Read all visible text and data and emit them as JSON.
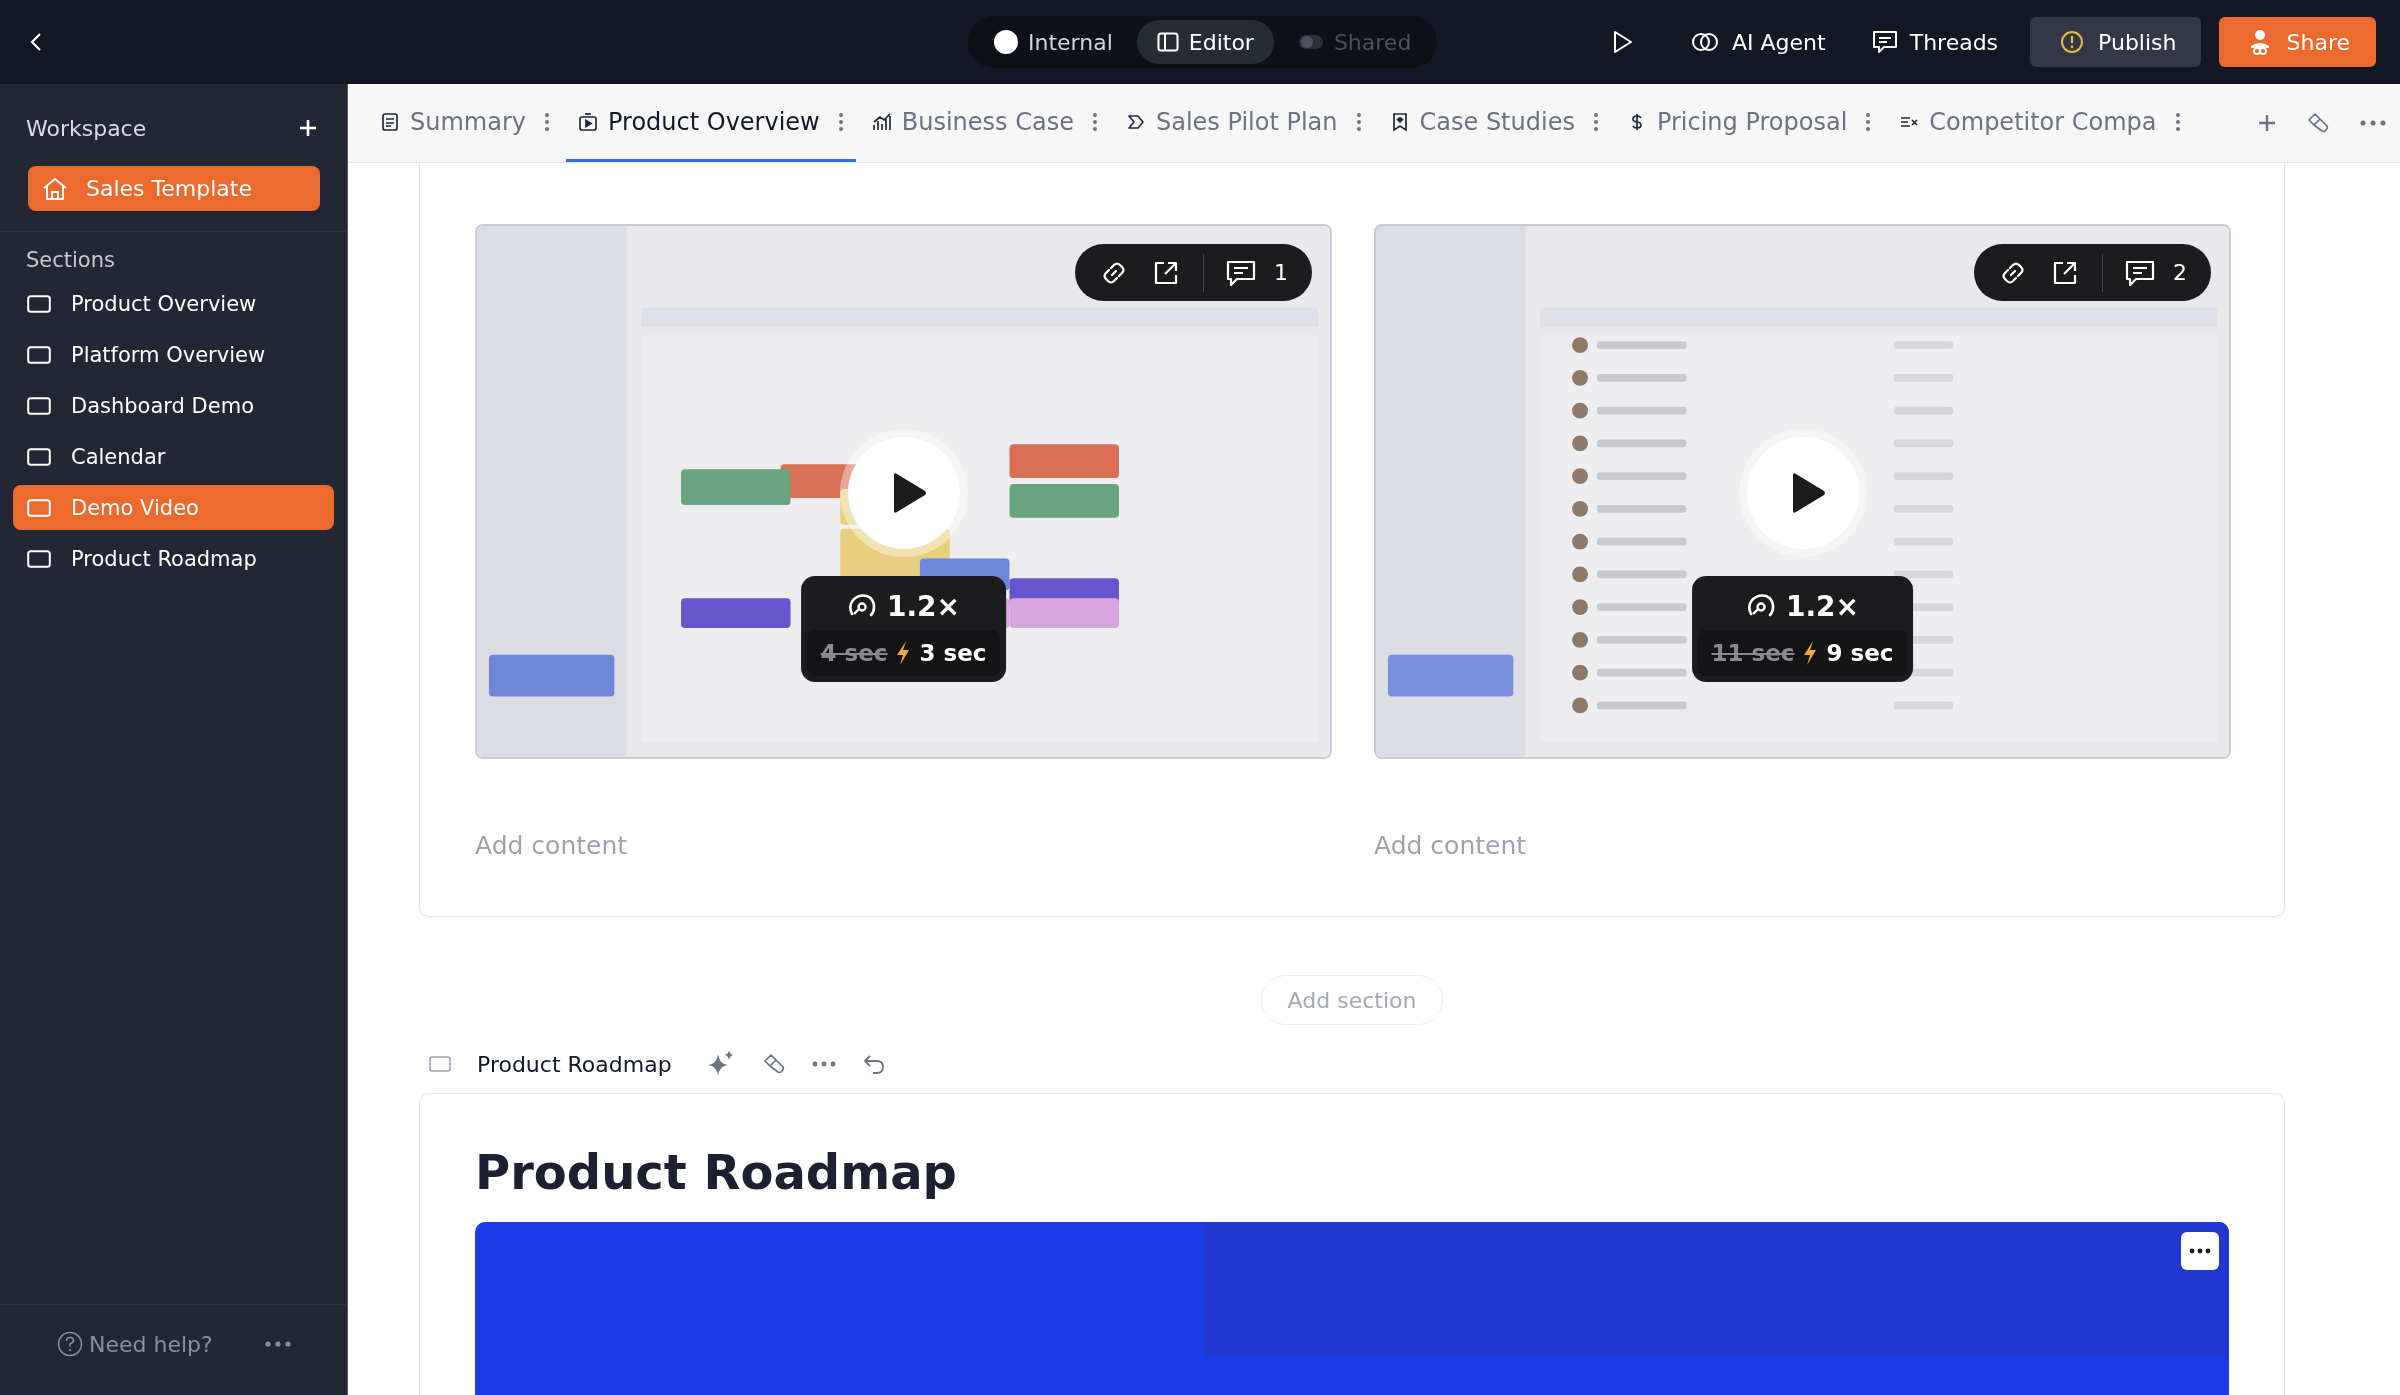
{
  "top_bar": {
    "modes": [
      {
        "label": "Internal",
        "kind": "dot",
        "selected": false,
        "disabled": false
      },
      {
        "label": "Editor",
        "kind": "panel",
        "selected": true,
        "disabled": false
      },
      {
        "label": "Shared",
        "kind": "toggle",
        "selected": false,
        "disabled": true
      }
    ],
    "actions": [
      {
        "label": "AI Agent",
        "kind": "agent"
      },
      {
        "label": "Threads",
        "kind": "threads"
      }
    ],
    "publish": "Publish",
    "share": "Share"
  },
  "sidebar": {
    "title": "Workspace",
    "home": "Sales Template",
    "sections_title": "Sections",
    "items": [
      {
        "label": "Product Overview",
        "selected": false
      },
      {
        "label": "Platform Overview",
        "selected": false
      },
      {
        "label": "Dashboard Demo",
        "selected": false
      },
      {
        "label": "Calendar",
        "selected": false
      },
      {
        "label": "Demo Video",
        "selected": true
      },
      {
        "label": "Product Roadmap",
        "selected": false
      }
    ],
    "help": "Need help?"
  },
  "tabs": [
    {
      "label": "Summary",
      "kind": "doc",
      "selected": false
    },
    {
      "label": "Product Overview",
      "kind": "video",
      "selected": true
    },
    {
      "label": "Business Case",
      "kind": "chart",
      "selected": false
    },
    {
      "label": "Sales Pilot Plan",
      "kind": "chevron",
      "selected": false
    },
    {
      "label": "Case Studies",
      "kind": "bookmark",
      "selected": false
    },
    {
      "label": "Pricing Proposal",
      "kind": "dollar",
      "selected": false
    },
    {
      "label": "Competitor Compa",
      "kind": "compare",
      "selected": false
    }
  ],
  "videos": [
    {
      "comments": "1",
      "speed": "1.2×",
      "old_duration": "4 sec",
      "new_duration": "3 sec",
      "footer": "Add content"
    },
    {
      "comments": "2",
      "speed": "1.2×",
      "old_duration": "11 sec",
      "new_duration": "9 sec",
      "footer": "Add content"
    }
  ],
  "add_section": "Add section",
  "roadmap": {
    "label": "Product Roadmap",
    "heading": "Product Roadmap"
  }
}
